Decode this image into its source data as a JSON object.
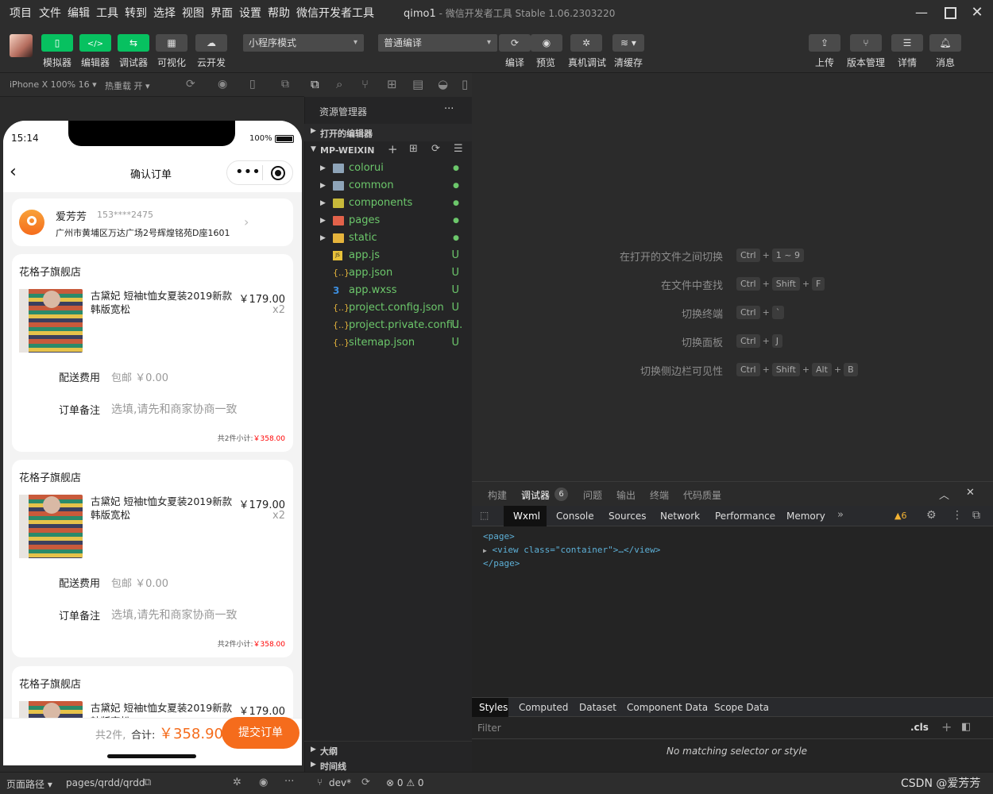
{
  "menu": [
    "项目",
    "文件",
    "编辑",
    "工具",
    "转到",
    "选择",
    "视图",
    "界面",
    "设置",
    "帮助",
    "微信开发者工具"
  ],
  "window": {
    "title": "qimo1",
    "subtitle": " - 微信开发者工具 Stable 1.06.2303220"
  },
  "toolbar": {
    "left": [
      {
        "label": "模拟器",
        "icon": "phone-icon"
      },
      {
        "label": "编辑器",
        "icon": "code-icon"
      },
      {
        "label": "调试器",
        "icon": "debug-swap-icon"
      },
      {
        "label": "可视化",
        "icon": "layout-icon"
      },
      {
        "label": "云开发",
        "icon": "cloud-icon"
      }
    ],
    "mode_select": "小程序模式",
    "compile_select": "普通编译",
    "middle": [
      {
        "label": "编译",
        "icon": "refresh-icon"
      },
      {
        "label": "预览",
        "icon": "eye-icon"
      },
      {
        "label": "真机调试",
        "icon": "bug-icon"
      },
      {
        "label": "清缓存",
        "icon": "layers-icon"
      }
    ],
    "right": [
      {
        "label": "上传",
        "icon": "upload-icon"
      },
      {
        "label": "版本管理",
        "icon": "branch-icon"
      },
      {
        "label": "详情",
        "icon": "menu-icon"
      },
      {
        "label": "消息",
        "icon": "bell-icon"
      }
    ]
  },
  "simulator": {
    "device": "iPhone X 100% 16 ▾",
    "hotreload": "热重载 开 ▾",
    "status_time": "15:14",
    "battery": "100%",
    "nav_title": "确认订单",
    "address": {
      "name": "爱芳芳",
      "phone": "153****2475",
      "detail": "广州市黄埔区万达广场2号辉煌铭苑D座1601"
    },
    "orders": [
      {
        "shop": "花格子旗舰店",
        "title": "古黛妃 短袖t恤女夏装2019新款韩版宽松",
        "price": "￥179.00",
        "qty": "x2",
        "ship_label": "配送费用",
        "ship_value": "包邮 ￥0.00",
        "note_label": "订单备注",
        "note_placeholder": "选填,请先和商家协商一致",
        "subtotal_prefix": "共2件小计:",
        "subtotal": "￥358.00"
      },
      {
        "shop": "花格子旗舰店",
        "title": "古黛妃 短袖t恤女夏装2019新款韩版宽松",
        "price": "￥179.00",
        "qty": "x2",
        "ship_label": "配送费用",
        "ship_value": "包邮 ￥0.00",
        "note_label": "订单备注",
        "note_placeholder": "选填,请先和商家协商一致",
        "subtotal_prefix": "共2件小计:",
        "subtotal": "￥358.00"
      },
      {
        "shop": "花格子旗舰店",
        "title": "古黛妃 短袖t恤女夏装2019新款韩版宽松",
        "price": "￥179.00",
        "qty": "",
        "ship_label": "",
        "ship_value": "",
        "note_label": "",
        "note_placeholder": "",
        "subtotal_prefix": "",
        "subtotal": ""
      }
    ],
    "bottom": {
      "count": "共2件,",
      "total_label": "合计:",
      "total": "￥358.90",
      "submit": "提交订单"
    }
  },
  "explorer": {
    "title": "资源管理器",
    "more": "···",
    "open_editors": "打开的编辑器",
    "root": "MP-WEIXIN",
    "items": [
      {
        "name": "colorui",
        "type": "folder",
        "status": "●"
      },
      {
        "name": "common",
        "type": "folder",
        "status": "●"
      },
      {
        "name": "components",
        "type": "folder",
        "status": "●"
      },
      {
        "name": "pages",
        "type": "folder",
        "status": "●"
      },
      {
        "name": "static",
        "type": "folder",
        "status": "●"
      },
      {
        "name": "app.js",
        "type": "js",
        "status": "U"
      },
      {
        "name": "app.json",
        "type": "json",
        "status": "U"
      },
      {
        "name": "app.wxss",
        "type": "wxss",
        "status": "U"
      },
      {
        "name": "project.config.json",
        "type": "json",
        "status": "U"
      },
      {
        "name": "project.private.confi...",
        "type": "json",
        "status": "U"
      },
      {
        "name": "sitemap.json",
        "type": "json",
        "status": "U"
      }
    ],
    "outline": "大纲",
    "timeline": "时间线"
  },
  "editor": {
    "hints": [
      {
        "label": "在打开的文件之间切换",
        "keys": [
          "Ctrl",
          "1 ~ 9"
        ]
      },
      {
        "label": "在文件中查找",
        "keys": [
          "Ctrl",
          "Shift",
          "F"
        ]
      },
      {
        "label": "切换终端",
        "keys": [
          "Ctrl",
          "`"
        ]
      },
      {
        "label": "切换面板",
        "keys": [
          "Ctrl",
          "J"
        ]
      },
      {
        "label": "切换侧边栏可见性",
        "keys": [
          "Ctrl",
          "Shift",
          "Alt",
          "B"
        ]
      }
    ]
  },
  "panel": {
    "tabs": [
      "构建",
      "调试器",
      "问题",
      "输出",
      "终端",
      "代码质量"
    ],
    "badge": "6",
    "devtools_tabs": [
      "Wxml",
      "Console",
      "Sources",
      "Network",
      "Performance",
      "Memory"
    ],
    "more_tabs": "»",
    "warn_count": "▲6",
    "dom": [
      "<page>",
      "<view class=\"container\">…</view>",
      "</page>"
    ],
    "dom_attr_value": "\"container\"",
    "style_tabs": [
      "Styles",
      "Computed",
      "Dataset",
      "Component Data",
      "Scope Data"
    ],
    "filter_placeholder": "Filter",
    "cls": ".cls",
    "plus": "+",
    "no_match": "No matching selector or style"
  },
  "statusbar": {
    "path_label": "页面路径 ▾",
    "path": "pages/qrdd/qrdd",
    "branch": "dev*",
    "errors": "⊗ 0 ⚠ 0",
    "watermark": "CSDN @爱芳芳"
  },
  "colors": {
    "green": "#07c160",
    "orange": "#f56c1c",
    "price_red": "#f00",
    "file_green": "#6cc76b"
  }
}
